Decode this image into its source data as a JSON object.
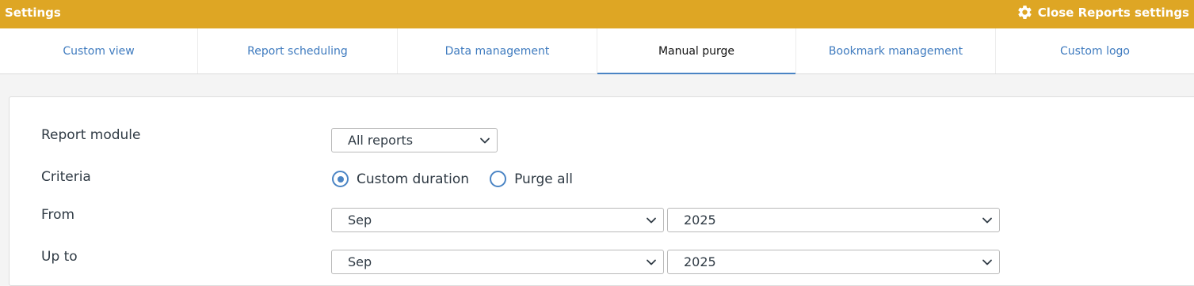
{
  "header": {
    "title": "Settings",
    "close_label": "Close Reports settings",
    "close_icon": "gear-icon",
    "background_color": "#dea624"
  },
  "tabs": [
    {
      "label": "Custom view",
      "active": false
    },
    {
      "label": "Report scheduling",
      "active": false
    },
    {
      "label": "Data management",
      "active": false
    },
    {
      "label": "Manual purge",
      "active": true
    },
    {
      "label": "Bookmark management",
      "active": false
    },
    {
      "label": "Custom logo",
      "active": false
    }
  ],
  "form": {
    "report_module": {
      "label": "Report module",
      "value": "All reports"
    },
    "criteria": {
      "label": "Criteria",
      "options": [
        "Custom duration",
        "Purge all"
      ],
      "selected": "Custom duration"
    },
    "from": {
      "label": "From",
      "month": "Sep",
      "year": "2025"
    },
    "up_to": {
      "label": "Up to",
      "month": "Sep",
      "year": "2025"
    }
  },
  "accent_color": "#4a84c4"
}
